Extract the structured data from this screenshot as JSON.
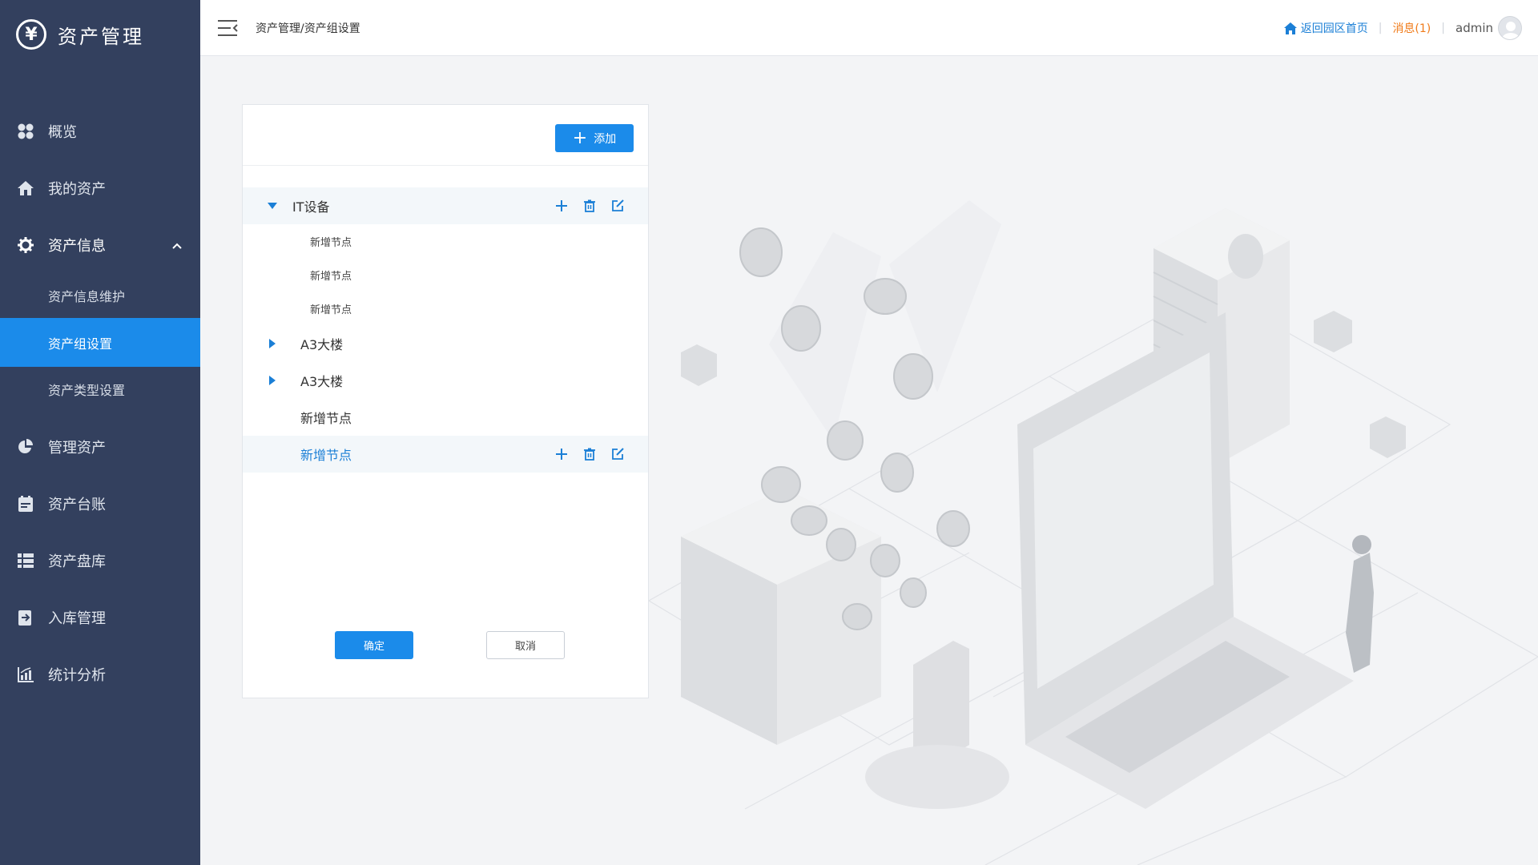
{
  "brand": {
    "logo_glyph": "¥",
    "title": "资产管理"
  },
  "sidebar": {
    "items": [
      {
        "label": "概览"
      },
      {
        "label": "我的资产"
      },
      {
        "label": "资产信息"
      },
      {
        "label": "管理资产"
      },
      {
        "label": "资产台账"
      },
      {
        "label": "资产盘库"
      },
      {
        "label": "入库管理"
      },
      {
        "label": "统计分析"
      }
    ],
    "subitems": [
      {
        "label": "资产信息维护"
      },
      {
        "label": "资产组设置"
      },
      {
        "label": "资产类型设置"
      }
    ],
    "active_subitem": "资产组设置"
  },
  "header": {
    "breadcrumb": "资产管理/资产组设置",
    "home_link": "返回园区首页",
    "messages": "消息(1)",
    "user": "admin"
  },
  "panel": {
    "add_label": "添加",
    "tree": [
      {
        "label": "IT设备",
        "expanded": true,
        "children": [
          "新增节点",
          "新增节点",
          "新增节点"
        ]
      },
      {
        "label": "A3大楼",
        "expanded": false
      },
      {
        "label": "A3大楼",
        "expanded": false
      },
      {
        "label": "新增节点"
      },
      {
        "label": "新增节点",
        "selected": true
      }
    ],
    "ok_label": "确定",
    "cancel_label": "取消"
  },
  "colors": {
    "sidebar_bg": "#33405e",
    "accent": "#1b8bea",
    "message": "#f07b1a"
  }
}
